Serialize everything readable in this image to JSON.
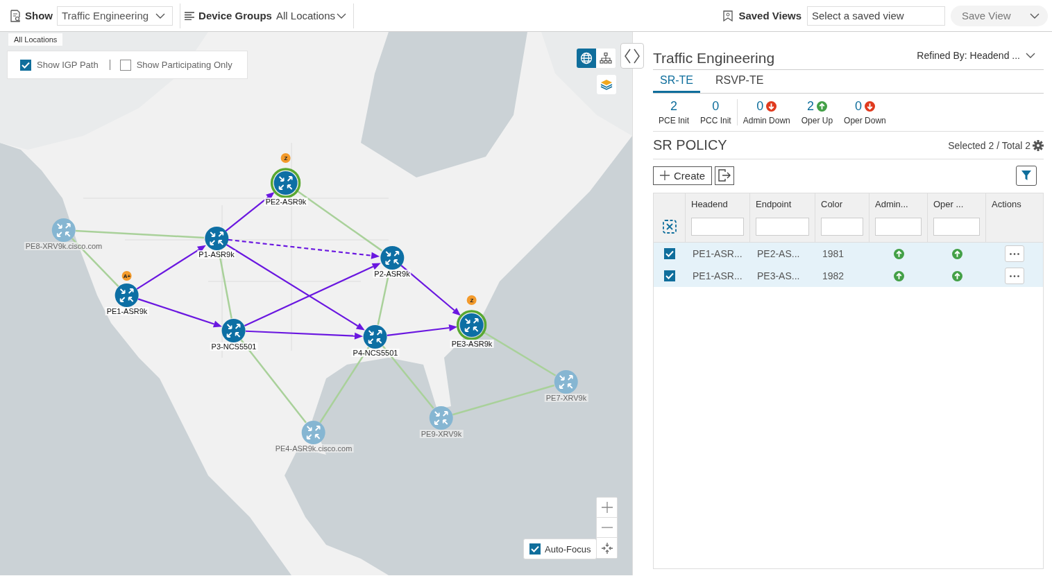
{
  "top_bar": {
    "show": {
      "label": "Show",
      "value": "Traffic Engineering"
    },
    "device_groups": {
      "label": "Device Groups",
      "value": "All Locations"
    },
    "saved_views": {
      "label": "Saved Views",
      "placeholder": "Select a saved view"
    },
    "save_view_button": "Save View"
  },
  "map": {
    "breadcrumb": "All Locations",
    "options": [
      {
        "label": "Show IGP Path",
        "checked": true
      },
      {
        "label": "Show Participating Only",
        "checked": false
      }
    ],
    "view_toggle": [
      {
        "kind": "geo",
        "selected": true
      },
      {
        "kind": "logical",
        "selected": false
      }
    ],
    "nodes": [
      {
        "name": "PE2-ASR9k",
        "participating": true,
        "endpoint": true,
        "badge": "Z"
      },
      {
        "name": "P1-ASR9k",
        "participating": true,
        "endpoint": false
      },
      {
        "name": "P2-ASR9k",
        "participating": true,
        "endpoint": false
      },
      {
        "name": "PE1-ASR9k",
        "participating": true,
        "endpoint": false,
        "badge": "A+"
      },
      {
        "name": "P3-NCS5501",
        "participating": true,
        "endpoint": false
      },
      {
        "name": "P4-NCS5501",
        "participating": true,
        "endpoint": false
      },
      {
        "name": "PE3-ASR9k",
        "participating": true,
        "endpoint": true,
        "badge": "Z"
      },
      {
        "name": "PE8-XRV9k.cisco.com",
        "participating": false,
        "endpoint": false
      },
      {
        "name": "PE7-XRV9k",
        "participating": false,
        "endpoint": false
      },
      {
        "name": "PE9-XRV9k",
        "participating": false,
        "endpoint": false
      },
      {
        "name": "PE4-ASR9k.cisco.com",
        "participating": false,
        "endpoint": false
      }
    ],
    "links": [
      {
        "kind": "sr-path"
      },
      {
        "kind": "sr-path"
      },
      {
        "kind": "sr-path-dashed"
      },
      {
        "kind": "sr-path"
      },
      {
        "kind": "sr-path"
      },
      {
        "kind": "sr-path"
      },
      {
        "kind": "sr-path"
      },
      {
        "kind": "sr-path"
      },
      {
        "kind": "sr-path"
      },
      {
        "kind": "igp-link"
      },
      {
        "kind": "igp-link"
      },
      {
        "kind": "igp-link"
      },
      {
        "kind": "igp-link"
      },
      {
        "kind": "igp-link"
      },
      {
        "kind": "igp-link"
      },
      {
        "kind": "igp-link"
      },
      {
        "kind": "igp-link"
      },
      {
        "kind": "igp-link"
      },
      {
        "kind": "igp-link"
      }
    ],
    "auto_focus": {
      "label": "Auto-Focus",
      "checked": true
    }
  },
  "panel": {
    "title": "Traffic Engineering",
    "refined_by": "Refined By: Headend ...",
    "tabs": [
      {
        "label": "SR-TE",
        "selected": true
      },
      {
        "label": "RSVP-TE",
        "selected": false
      }
    ],
    "stat_groups": [
      [
        {
          "value": "2",
          "label": "PCE Init",
          "kind": "plain"
        },
        {
          "value": "0",
          "label": "PCC Init",
          "kind": "plain"
        }
      ],
      [
        {
          "value": "0",
          "label": "Admin Down",
          "kind": "down"
        },
        {
          "value": "2",
          "label": "Oper Up",
          "kind": "up"
        },
        {
          "value": "0",
          "label": "Oper Down",
          "kind": "down"
        }
      ]
    ],
    "policy": {
      "title": "SR POLICY",
      "summary": "Selected 2 / Total 2",
      "create_button": "Create",
      "columns": [
        {
          "label": "Headend",
          "filter": true
        },
        {
          "label": "Endpoint",
          "filter": true
        },
        {
          "label": "Color",
          "filter": true
        },
        {
          "label": "Admin...",
          "filter": true
        },
        {
          "label": "Oper ...",
          "filter": true
        },
        {
          "label": "Actions",
          "filter": false
        }
      ],
      "rows": [
        {
          "selected": true,
          "headend": "PE1-ASR...",
          "endpoint": "PE2-AS...",
          "policy_color": "1981",
          "admin_up": true,
          "oper_up": true
        },
        {
          "selected": true,
          "headend": "PE1-ASR...",
          "endpoint": "PE3-AS...",
          "policy_color": "1982",
          "admin_up": true,
          "oper_up": true
        }
      ]
    }
  }
}
